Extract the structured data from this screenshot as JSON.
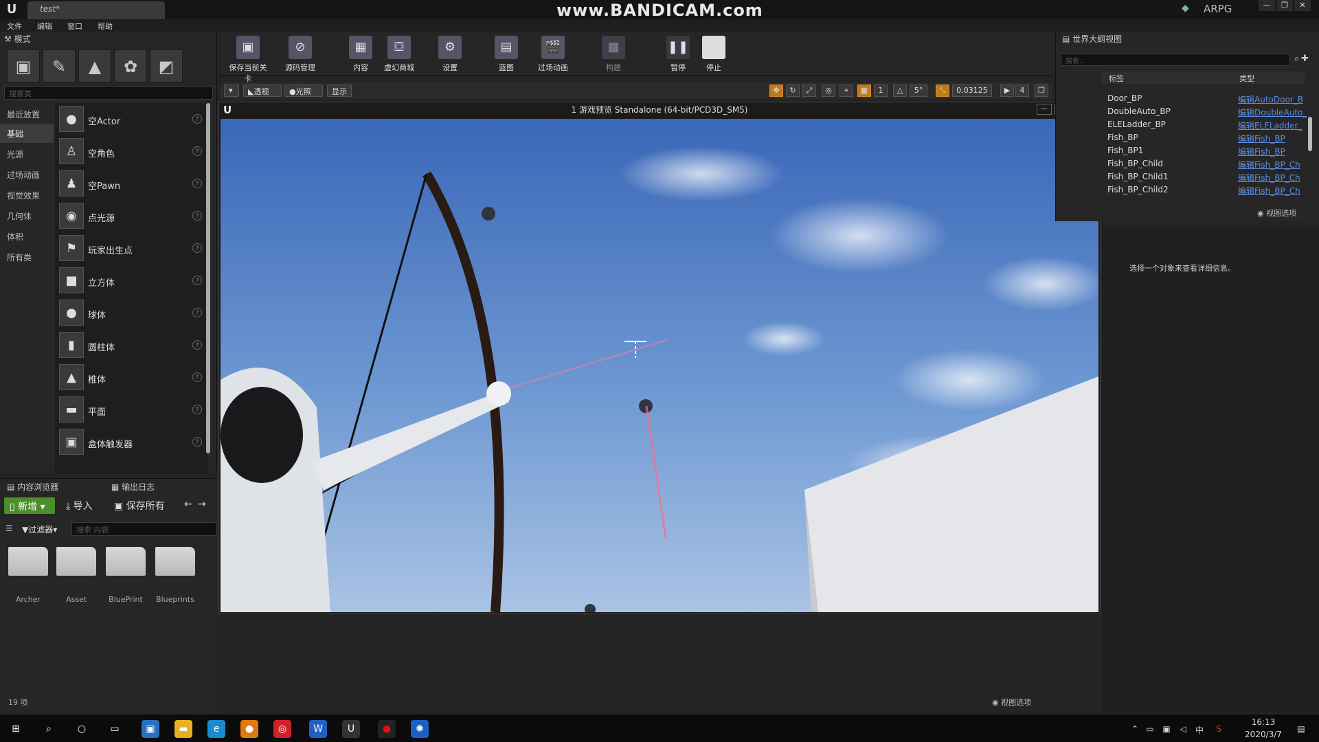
{
  "titlebar": {
    "tab": "test*",
    "watermark": "www.BANDICAM.com",
    "project": "ARPG"
  },
  "menu": [
    "文件",
    "编辑",
    "窗口",
    "帮助"
  ],
  "modes": {
    "tab": "模式",
    "search_placeholder": "搜索类",
    "categories": [
      "最近放置",
      "基础",
      "光源",
      "过场动画",
      "视觉效果",
      "几何体",
      "体积",
      "所有类"
    ],
    "items": [
      "空Actor",
      "空角色",
      "空Pawn",
      "点光源",
      "玩家出生点",
      "立方体",
      "球体",
      "圆柱体",
      "椎体",
      "平面",
      "盒体触发器"
    ]
  },
  "content_browser": {
    "tab": "内容浏览器",
    "log_tab": "输出日志",
    "new": "新增",
    "import": "导入",
    "save_all": "保存所有",
    "filter": "过滤器",
    "search_placeholder": "搜索 内容",
    "folders": [
      "Archer",
      "Asset",
      "BluePrint",
      "Blueprints"
    ],
    "count": "19 项",
    "view_options": "视图选项"
  },
  "toolbar": {
    "items": [
      "保存当前关卡",
      "源码管理",
      "内容",
      "虚幻商城",
      "设置",
      "蓝图",
      "过场动画",
      "构建",
      "暂停",
      "停止"
    ]
  },
  "viewport": {
    "perspective": "透视",
    "lit": "光照",
    "show": "显示",
    "angle": "5°",
    "scale": "0.03125",
    "grid_count": "1",
    "camera_speed": "4"
  },
  "game_window": {
    "title": "1 游戏预览 Standalone (64-bit/PCD3D_SM5)"
  },
  "outliner": {
    "tab": "世界大纲视图",
    "search_placeholder": "搜索...",
    "col_label": "标签",
    "col_type": "类型",
    "view_options": "视图选项",
    "rows": [
      {
        "name": "Door_BP",
        "type": "编辑AutoDoor_B"
      },
      {
        "name": "DoubleAuto_BP",
        "type": "编辑DoubleAuto_"
      },
      {
        "name": "ELELadder_BP",
        "type": "编辑ELELadder_"
      },
      {
        "name": "Fish_BP",
        "type": "编辑Fish_BP"
      },
      {
        "name": "Fish_BP1",
        "type": "编辑Fish_BP"
      },
      {
        "name": "Fish_BP_Child",
        "type": "编辑Fish_BP_Ch"
      },
      {
        "name": "Fish_BP_Child1",
        "type": "编辑Fish_BP_Ch"
      },
      {
        "name": "Fish_BP_Child2",
        "type": "编辑Fish_BP_Ch"
      }
    ]
  },
  "details": {
    "hint": "选择一个对象来查看详细信息。"
  },
  "taskbar": {
    "time": "16:13",
    "date": "2020/3/7",
    "ime": "中"
  },
  "colors": {
    "accent_green": "#4a8f2a",
    "link_blue": "#5a8de0",
    "snap_orange": "#c07a1a"
  }
}
